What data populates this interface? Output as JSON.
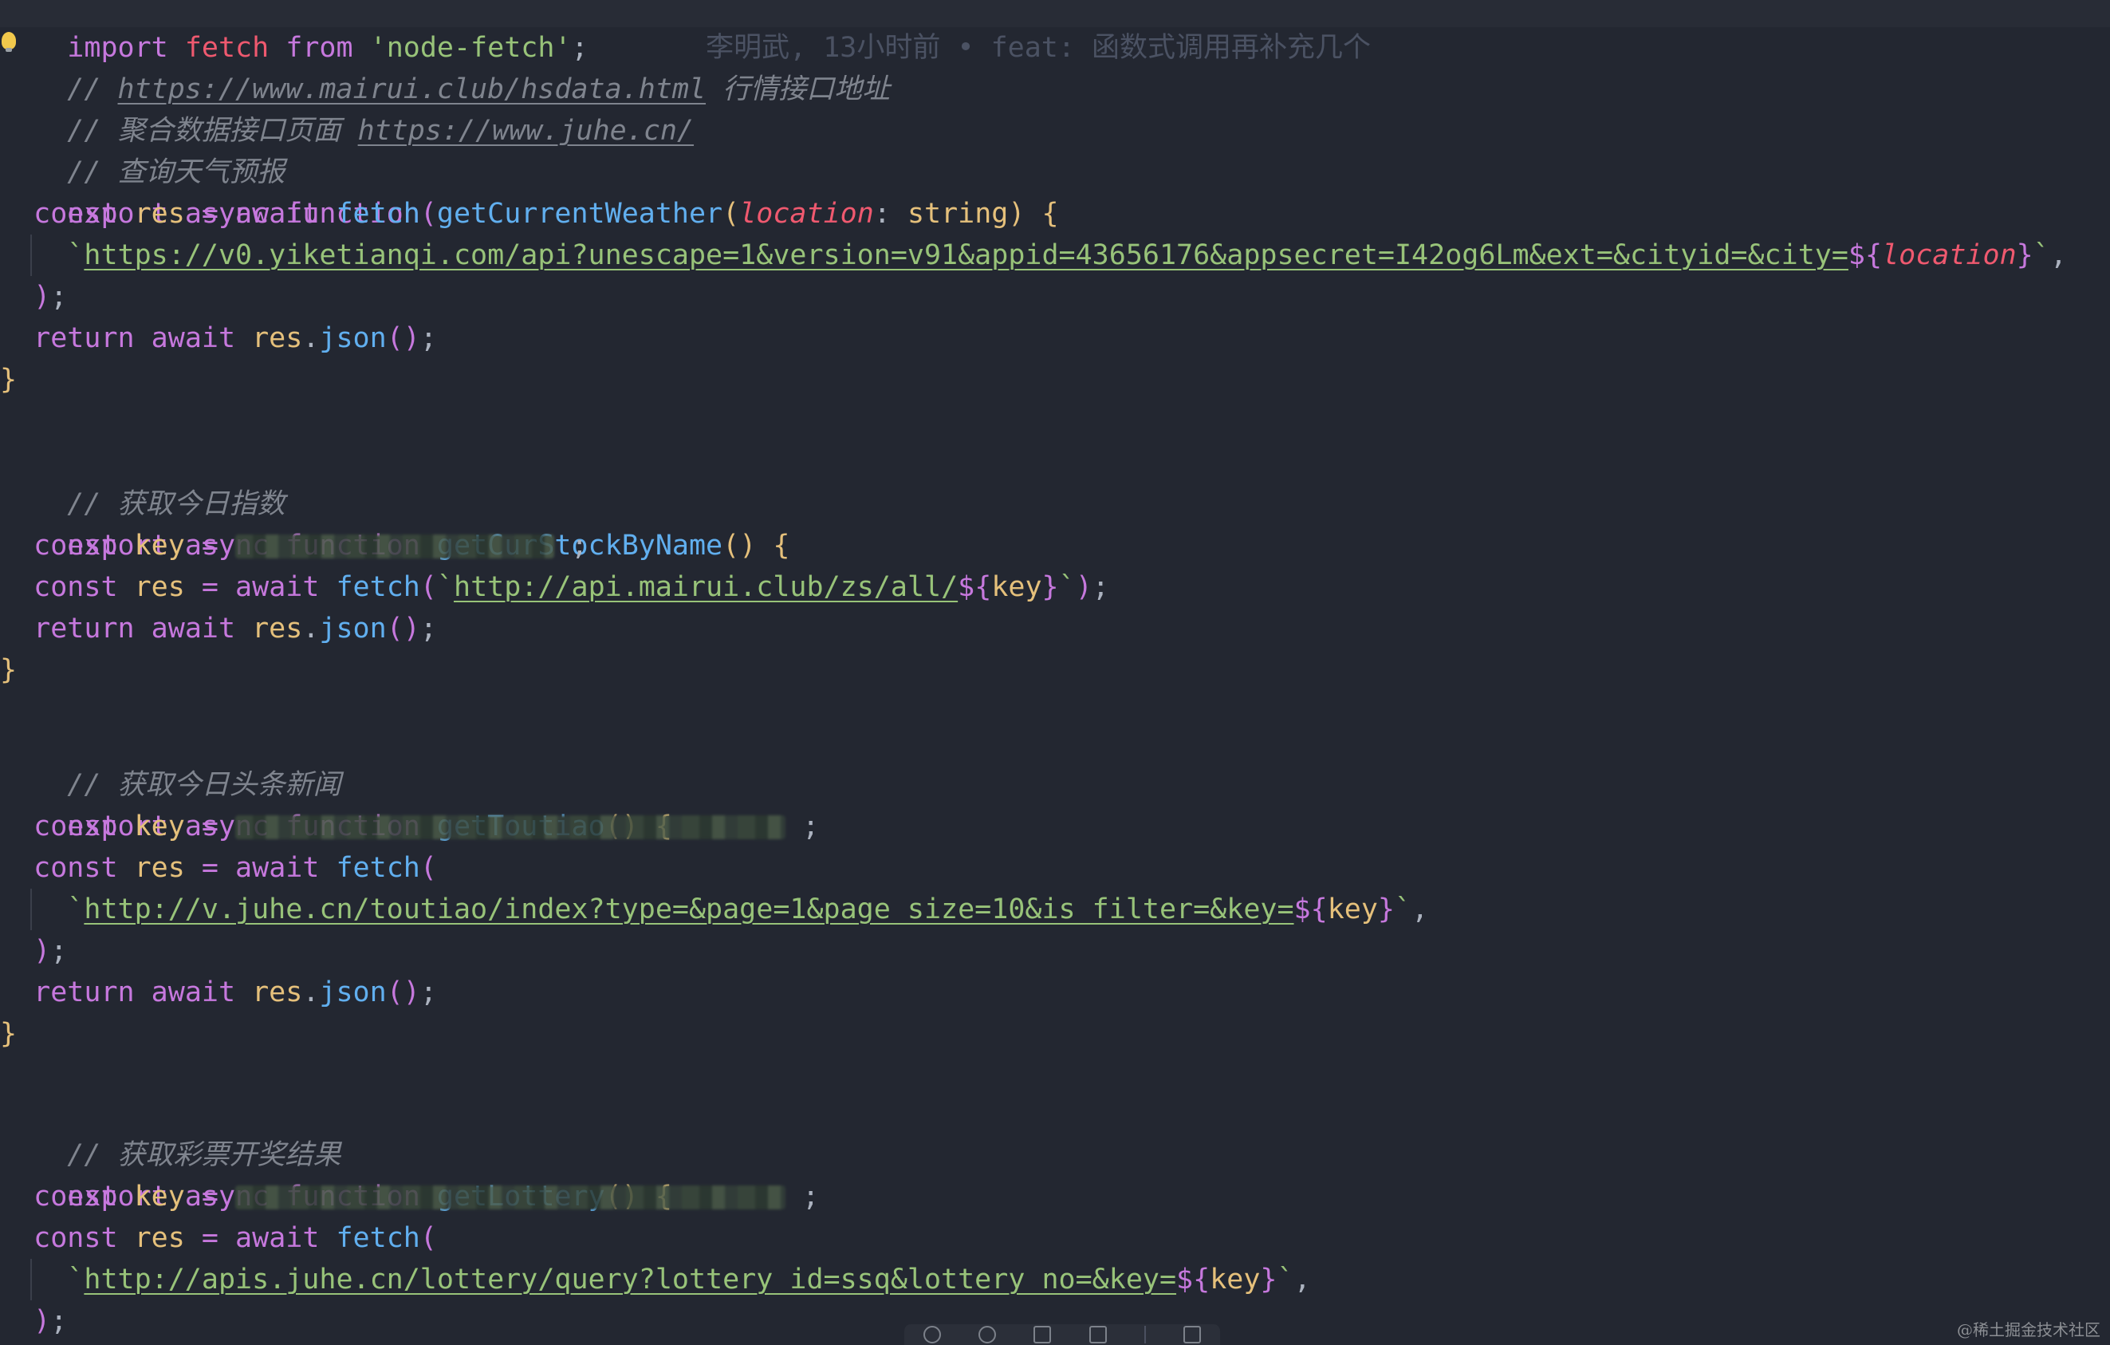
{
  "editor": {
    "blame": "李明武, 13小时前 • feat: 函数式调用再补充几个",
    "line1": {
      "kw_import": "import",
      "fetch": "fetch",
      "kw_from": "from",
      "module": "'node-fetch'",
      "semi": ";"
    },
    "comment1": {
      "prefix": "// ",
      "link": "https://www.mairui.club/hsdata.html",
      "text": " 行情接口地址"
    },
    "comment2": {
      "prefix": "// 聚合数据接口页面 ",
      "link": "https://www.juhe.cn/"
    },
    "comment3": "// 查询天气预报",
    "weather": {
      "name": "getCurrentWeather",
      "param": "location",
      "ptype": "string",
      "url": "https://v0.yiketianqi.com/api?unescape=1&version=v91&appid=43656176&appsecret=I42og6Lm&ext=&cityid=&city=",
      "tplvar": "location"
    },
    "comment4": "// 获取今日指数",
    "stock": {
      "name": "getCurStockByName",
      "url": "http://api.mairui.club/zs/all/",
      "tplvar": "key"
    },
    "comment5": "// 获取今日头条新闻",
    "toutiao": {
      "name": "getToutiao",
      "url": "http://v.juhe.cn/toutiao/index?type=&page=1&page_size=10&is_filter=&key=",
      "tplvar": "key"
    },
    "comment6": "// 获取彩票开奖结果",
    "lottery": {
      "name": "getLottery",
      "url": "http://apis.juhe.cn/lottery/query?lottery_id=ssq&lottery_no=&key=",
      "tplvar": "key"
    },
    "tokens": {
      "export": "export",
      "async": "async",
      "function": "function",
      "const": "const",
      "res": "res",
      "key": "key",
      "await": "await",
      "fetch": "fetch",
      "return": "return",
      "json": "json",
      "eq": "=",
      "dot": "."
    }
  },
  "watermark": "@稀土掘金技术社区",
  "colors": {
    "background": "#232731",
    "keyword": "#c678dd",
    "function": "#61afef",
    "variable": "#e5c07b",
    "string": "#98c379",
    "parameter": "#ef596f",
    "comment": "#7f848e"
  }
}
